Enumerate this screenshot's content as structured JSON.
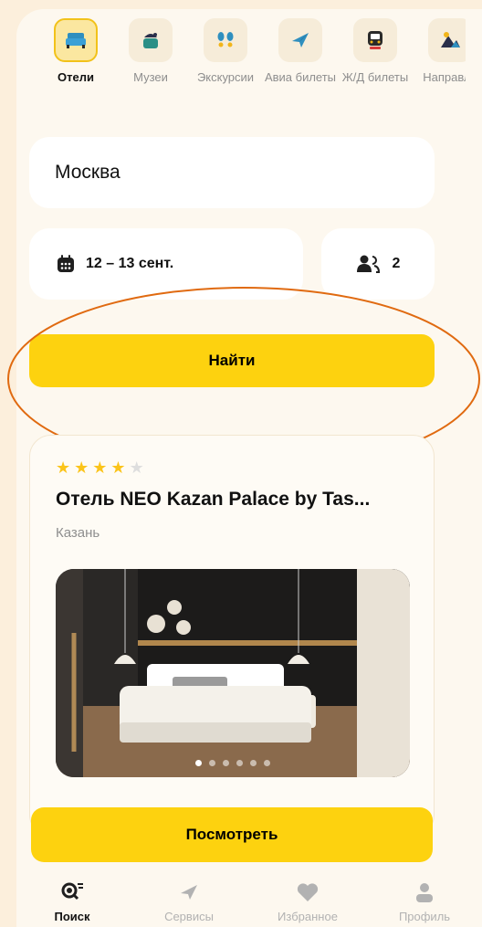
{
  "categories": [
    {
      "id": "hotels",
      "label": "Отели",
      "icon": "bed-icon",
      "active": true
    },
    {
      "id": "museums",
      "label": "Музеи",
      "icon": "museum-icon",
      "active": false
    },
    {
      "id": "excursions",
      "label": "Экскурсии",
      "icon": "footprints-icon",
      "active": false
    },
    {
      "id": "avia",
      "label": "Авиа билеты",
      "icon": "plane-icon",
      "active": false
    },
    {
      "id": "rail",
      "label": "Ж/Д билеты",
      "icon": "train-icon",
      "active": false
    },
    {
      "id": "directions",
      "label": "Направле",
      "icon": "mountain-icon",
      "active": false
    }
  ],
  "search": {
    "city": "Москва",
    "dates": "12 – 13 сент.",
    "guests": "2",
    "find_label": "Найти"
  },
  "hotel": {
    "stars_filled": 4,
    "stars_total": 5,
    "name": "Отель NEO Kazan Palace by Tas...",
    "city": "Казань",
    "photo_slides": 6,
    "photo_active_slide": 1,
    "view_label": "Посмотреть"
  },
  "nav": [
    {
      "label": "Поиск",
      "icon": "search-icon",
      "active": true
    },
    {
      "label": "Сервисы",
      "icon": "plane-icon",
      "active": false
    },
    {
      "label": "Избранное",
      "icon": "heart-icon",
      "active": false
    },
    {
      "label": "Профиль",
      "icon": "user-icon",
      "active": false
    }
  ],
  "colors": {
    "accent": "#FDD20F",
    "background": "#FDF8EF",
    "annotation_ring": "#E06A10"
  }
}
